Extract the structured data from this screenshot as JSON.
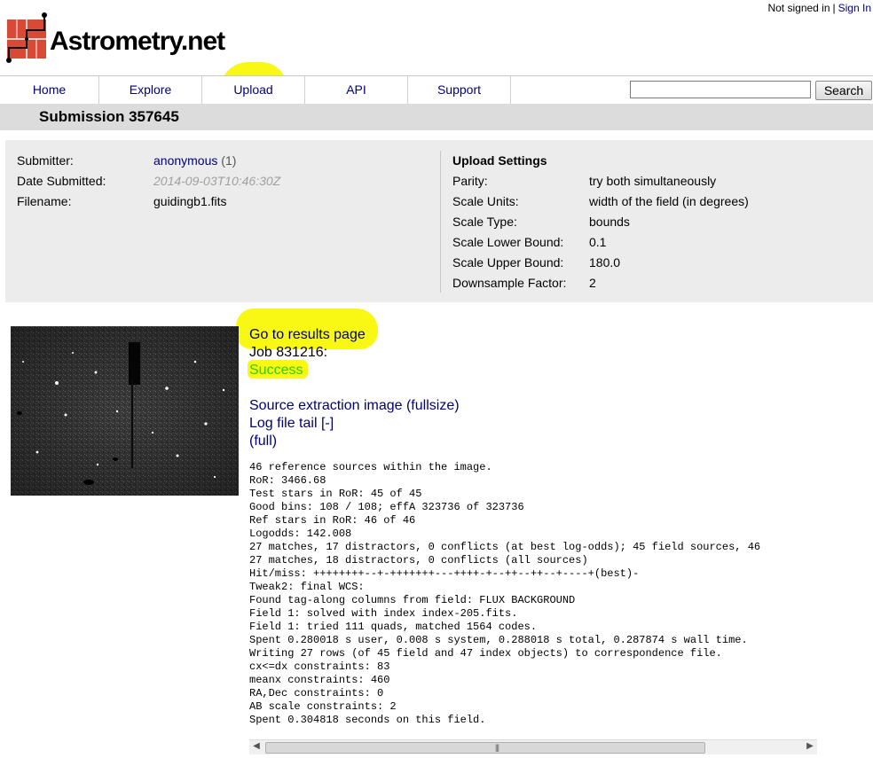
{
  "auth": {
    "status": "Not signed in",
    "separator": "|",
    "sign_in": "Sign In"
  },
  "logo": {
    "text": "Astrometry.net"
  },
  "nav": {
    "tabs": [
      "Home",
      "Explore",
      "Upload",
      "API",
      "Support"
    ],
    "search_placeholder": "",
    "search_button": "Search"
  },
  "page_title": "Submission 357645",
  "submission": {
    "submitter_label": "Submitter:",
    "submitter_name": "anonymous",
    "submitter_count": "(1)",
    "date_label": "Date Submitted:",
    "date_value": "2014-09-03T10:46:30Z",
    "filename_label": "Filename:",
    "filename_value": "guidingb1.fits"
  },
  "upload_settings": {
    "heading": "Upload Settings",
    "rows": [
      {
        "label": "Parity:",
        "value": "try both simultaneously"
      },
      {
        "label": "Scale Units:",
        "value": "width of the field (in degrees)"
      },
      {
        "label": "Scale Type:",
        "value": "bounds"
      },
      {
        "label": "Scale Lower Bound:",
        "value": "0.1"
      },
      {
        "label": "Scale Upper Bound:",
        "value": "180.0"
      },
      {
        "label": "Downsample Factor:",
        "value": "2"
      }
    ]
  },
  "job": {
    "results_link": "Go to results page",
    "job_label": "Job 831216:",
    "status": "Success",
    "status_color": "#2ecc00",
    "source_extraction_link": "Source extraction image (fullsize)",
    "log_tail_link": "Log file tail [-]",
    "full_link": "(full)"
  },
  "log_lines": [
    "46 reference sources within the image.",
    "RoR: 3466.68",
    "Test stars in RoR: 45 of 45",
    "Good bins: 108 / 108; effA 323736 of 323736",
    "Ref stars in RoR: 46 of 46",
    "Logodds: 142.008",
    "27 matches, 17 distractors, 0 conflicts (at best log-odds); 45 field sources, 46",
    "27 matches, 18 distractors, 0 conflicts (all sources)",
    "Hit/miss: ++++++++--+-+++++++---++++-+--++--++--+----+(best)-",
    "Tweak2: final WCS:",
    "Found tag-along columns from field: FLUX BACKGROUND",
    "Field 1: solved with index index-205.fits.",
    "Field 1: tried 111 quads, matched 1564 codes.",
    "Spent 0.280018 s user, 0.008 s system, 0.288018 s total, 0.287874 s wall time.",
    "Writing 27 rows (of 45 field and 47 index objects) to correspondence file.",
    "cx<=dx constraints: 83",
    "meanx constraints: 460",
    "RA,Dec constraints: 0",
    "AB scale constraints: 2",
    "Spent 0.304818 seconds on this field."
  ],
  "colors": {
    "link": "#00007a",
    "highlight": "#f7f700",
    "title_bar": "#dcdcdc",
    "panel": "#ececec"
  }
}
